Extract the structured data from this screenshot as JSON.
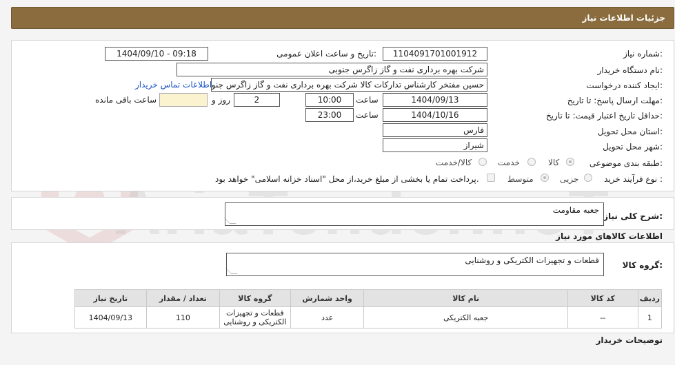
{
  "header": {
    "title": "جزئیات اطلاعات نیاز"
  },
  "fields": {
    "need_number": {
      "label": "شماره نیاز:",
      "value": "1104091701001912"
    },
    "announce_datetime": {
      "label": "تاریخ و ساعت اعلان عمومی:",
      "value": "1404/09/10 - 09:18"
    },
    "buyer_org": {
      "label": "نام دستگاه خریدار:",
      "value": "شرکت بهره برداری نفت و گاز زاگرس جنوبی"
    },
    "requester": {
      "label": "ایجاد کننده درخواست:",
      "value": "حسین مفتخر کارشناس تدارکات کالا شرکت بهره برداری نفت و گاز زاگرس جنوبی"
    },
    "contact_link": "اطلاعات تماس خریدار",
    "reply_deadline": {
      "label": "مهلت ارسال پاسخ: تا تاریخ:",
      "date": "1404/09/13",
      "time_label": "ساعت",
      "time": "10:00",
      "days": "2",
      "days_label": "روز و",
      "remaining": "",
      "remaining_label": "ساعت باقی مانده"
    },
    "price_validity": {
      "label": "حداقل تاریخ اعتبار قیمت: تا تاریخ:",
      "date": "1404/10/16",
      "time_label": "ساعت",
      "time": "23:00"
    },
    "province": {
      "label": "استان محل تحویل:",
      "value": "فارس"
    },
    "city": {
      "label": "شهر محل تحویل:",
      "value": "شیراز"
    },
    "category": {
      "label": "طبقه بندی موضوعی:",
      "options": [
        "کالا",
        "خدمت",
        "کالا/خدمت"
      ],
      "selected": "کالا"
    },
    "process_type": {
      "label": "نوع فرآیند خرید :",
      "options": [
        "جزیی",
        "متوسط"
      ],
      "selected": "متوسط",
      "payment_note": "پرداخت تمام یا بخشی از مبلغ خرید،از محل \"اسناد خزانه اسلامی\" خواهد بود."
    }
  },
  "description": {
    "label": "شرح کلی نیاز:",
    "value": "جعبه مقاومت"
  },
  "goods_info": {
    "title": "اطلاعات کالاهای مورد نیاز",
    "group_label": "گروه کالا:",
    "group_value": "قطعات و تجهیزات الکتریکی و روشنایی"
  },
  "table": {
    "headers": [
      "ردیف",
      "کد کالا",
      "نام کالا",
      "واحد شمارش",
      "گروه کالا",
      "تعداد / مقدار",
      "تاریخ نیاز"
    ],
    "rows": [
      [
        "1",
        "--",
        "جعبه الکتریکی",
        "عدد",
        "قطعات و تجهیزات الکتریکی و روشنایی",
        "110",
        "1404/09/13"
      ]
    ]
  },
  "buyer_notes": {
    "label": "توضیحات خریدار"
  },
  "watermark": {
    "text": "AriaTender.neT"
  },
  "colors": {
    "header_bg": "#8a6c3e",
    "link": "#1a55c6",
    "highlight": "#fbf3cf"
  }
}
